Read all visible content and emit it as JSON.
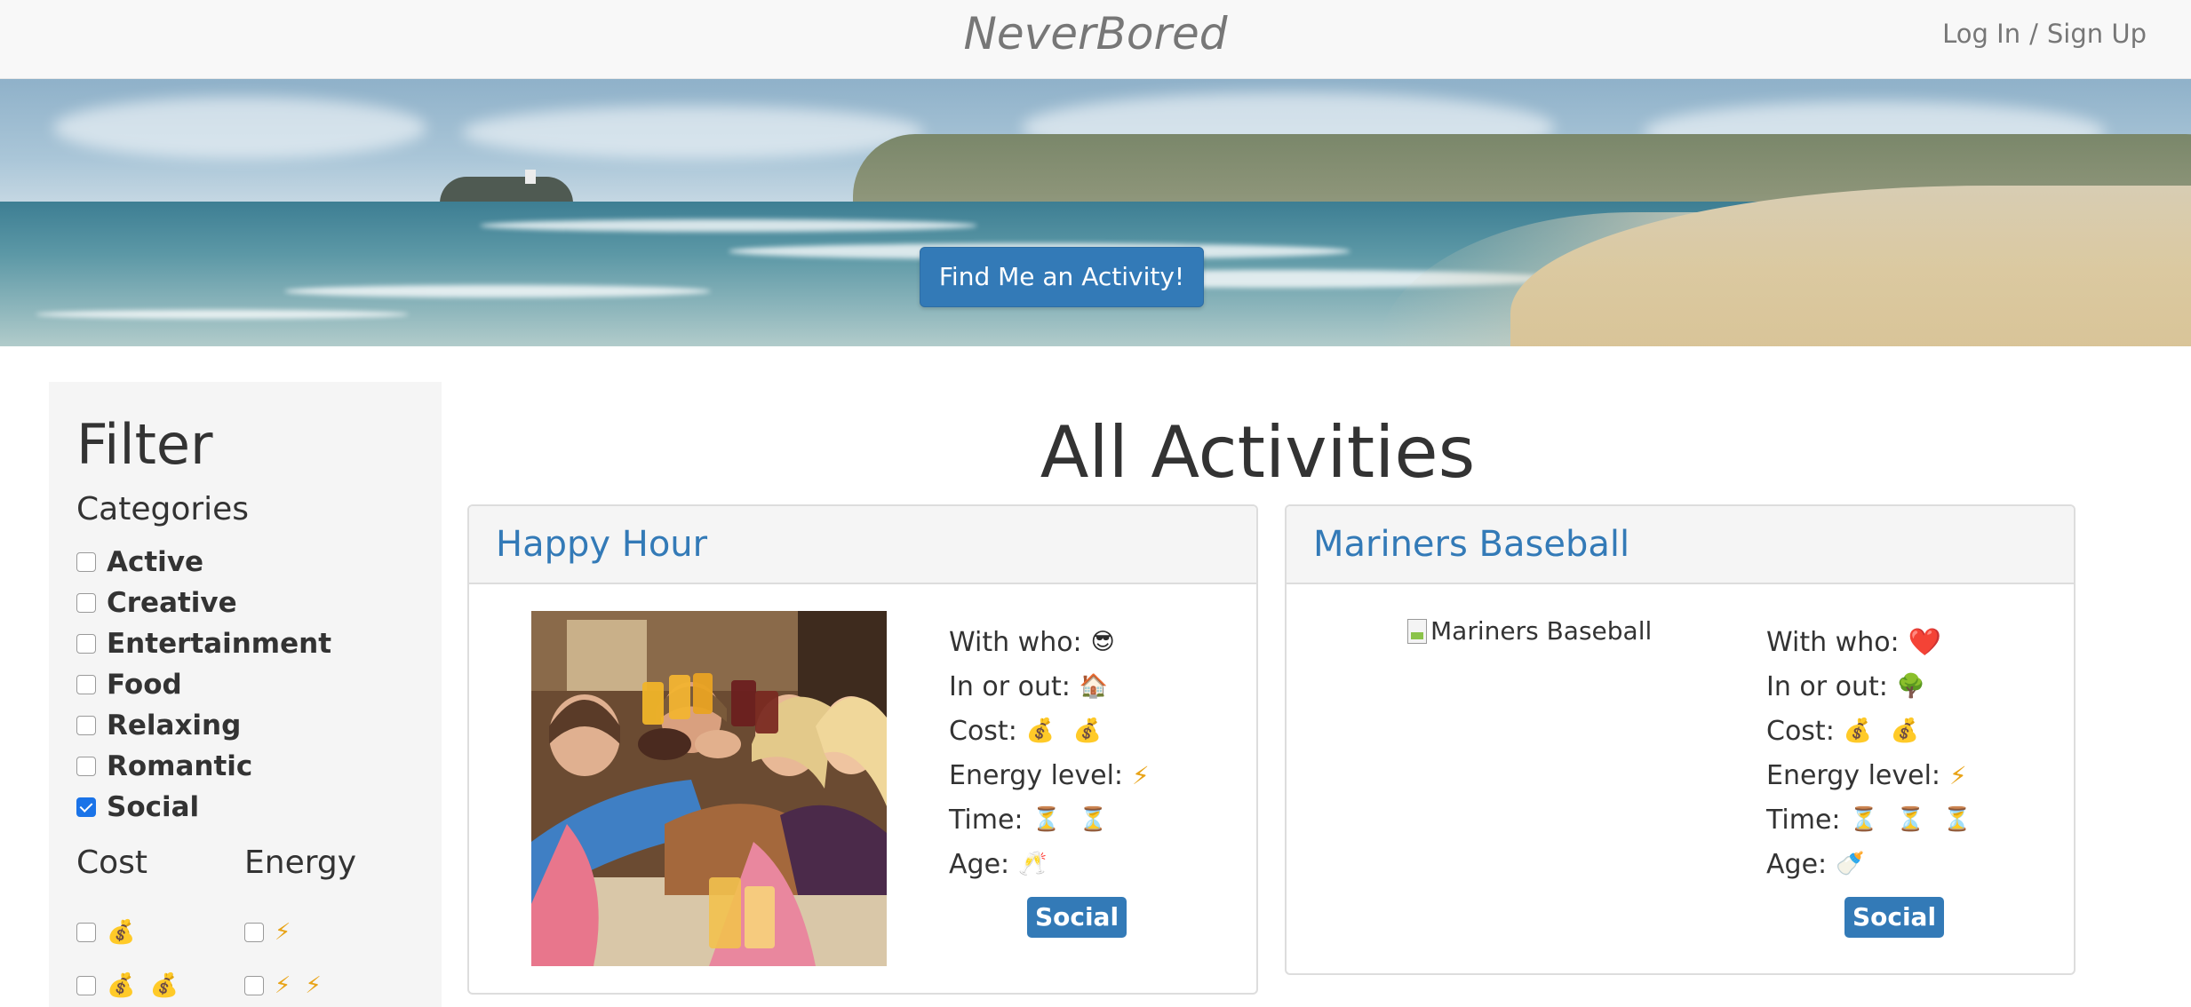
{
  "header": {
    "brand": "NeverBored",
    "login": "Log In",
    "separator": "/",
    "signup": "Sign Up"
  },
  "hero": {
    "cta_label": "Find Me an Activity!"
  },
  "sidebar": {
    "title": "Filter",
    "categories_heading": "Categories",
    "categories": [
      {
        "label": "Active",
        "checked": false
      },
      {
        "label": "Creative",
        "checked": false
      },
      {
        "label": "Entertainment",
        "checked": false
      },
      {
        "label": "Food",
        "checked": false
      },
      {
        "label": "Relaxing",
        "checked": false
      },
      {
        "label": "Romantic",
        "checked": false
      },
      {
        "label": "Social",
        "checked": true
      }
    ],
    "cost_heading": "Cost",
    "energy_heading": "Energy",
    "cost_options": [
      "💰",
      "💰 💰"
    ],
    "energy_options": [
      "⚡",
      "⚡ ⚡"
    ]
  },
  "main": {
    "title": "All Activities",
    "cards": [
      {
        "title": "Happy Hour",
        "image_alt": "",
        "with_who_label": "With who:",
        "with_who": "😎",
        "in_out_label": "In or out:",
        "in_out": "🏠",
        "cost_label": "Cost:",
        "cost": "💰 💰",
        "energy_label": "Energy level:",
        "energy": "⚡",
        "time_label": "Time:",
        "time": "⏳ ⏳",
        "age_label": "Age:",
        "age": "🥂",
        "tag": "Social"
      },
      {
        "title": "Mariners Baseball",
        "image_alt": "Mariners Baseball",
        "with_who_label": "With who:",
        "with_who": "❤️",
        "in_out_label": "In or out:",
        "in_out": "🌳",
        "cost_label": "Cost:",
        "cost": "💰 💰",
        "energy_label": "Energy level:",
        "energy": "⚡",
        "time_label": "Time:",
        "time": "⏳ ⏳ ⏳",
        "age_label": "Age:",
        "age": "🍼",
        "tag": "Social"
      }
    ]
  },
  "colors": {
    "primary": "#337ab7",
    "header_bg": "#f8f8f8",
    "sidebar_bg": "#f5f5f5",
    "checkbox_checked": "#1a73e8"
  },
  "icons": {
    "broken_image": "broken-image-icon",
    "photo": "happy-hour-photo"
  }
}
